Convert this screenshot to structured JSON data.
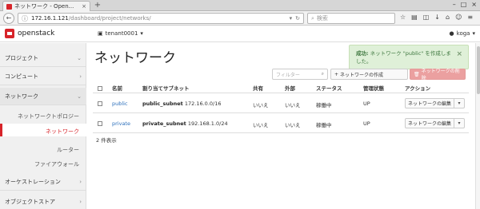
{
  "browser": {
    "tab_title": "ネットワーク - Open...",
    "tab_close": "×",
    "new_tab": "+",
    "window_controls": [
      "–",
      "□",
      "×"
    ],
    "url_host": "172.16.1.121",
    "url_path": "/dashboard/project/networks/",
    "search_placeholder": "検索"
  },
  "header": {
    "logo": "openstack",
    "tenant": "tenant0001",
    "user": "koga"
  },
  "sidebar": {
    "sections": [
      {
        "label": "プロジェクト",
        "chevron": "⌄"
      },
      {
        "label": "コンピュート",
        "chevron": "›"
      },
      {
        "label": "ネットワーク",
        "chevron": "⌄"
      },
      {
        "label": "オーケストレーション",
        "chevron": "›"
      },
      {
        "label": "オブジェクトストア",
        "chevron": "›"
      }
    ],
    "items": [
      {
        "label": "ネットワークトポロジー"
      },
      {
        "label": "ネットワーク"
      },
      {
        "label": "ルーター"
      },
      {
        "label": "ファイアウォール"
      }
    ]
  },
  "main": {
    "title": "ネットワーク",
    "filter_placeholder": "フィルター",
    "create_label": "ネットワークの作成",
    "delete_label": "ネットワークの削除",
    "toast": {
      "prefix": "成功:",
      "message": " ネットワーク \"public\" を作成しました。",
      "close": "×"
    },
    "columns": [
      "名前",
      "割り当てサブネット",
      "共有",
      "外部",
      "ステータス",
      "管理状態",
      "アクション"
    ],
    "rows": [
      {
        "name": "public",
        "subnet_name": "public_subnet",
        "subnet_cidr": "172.16.0.0/16",
        "shared": "いいえ",
        "external": "いいえ",
        "status": "稼働中",
        "admin_state": "UP",
        "action": "ネットワークの編集"
      },
      {
        "name": "private",
        "subnet_name": "private_subnet",
        "subnet_cidr": "192.168.1.0/24",
        "shared": "いいえ",
        "external": "いいえ",
        "status": "稼働中",
        "admin_state": "UP",
        "action": "ネットワークの編集"
      }
    ],
    "count_text": "2 件表示"
  },
  "colors": {
    "brand": "#d7242a",
    "link": "#2a6ebb",
    "toast_bg": "#dff0d8",
    "toast_text": "#3c763d",
    "delete_btn": "#eba0a0"
  }
}
